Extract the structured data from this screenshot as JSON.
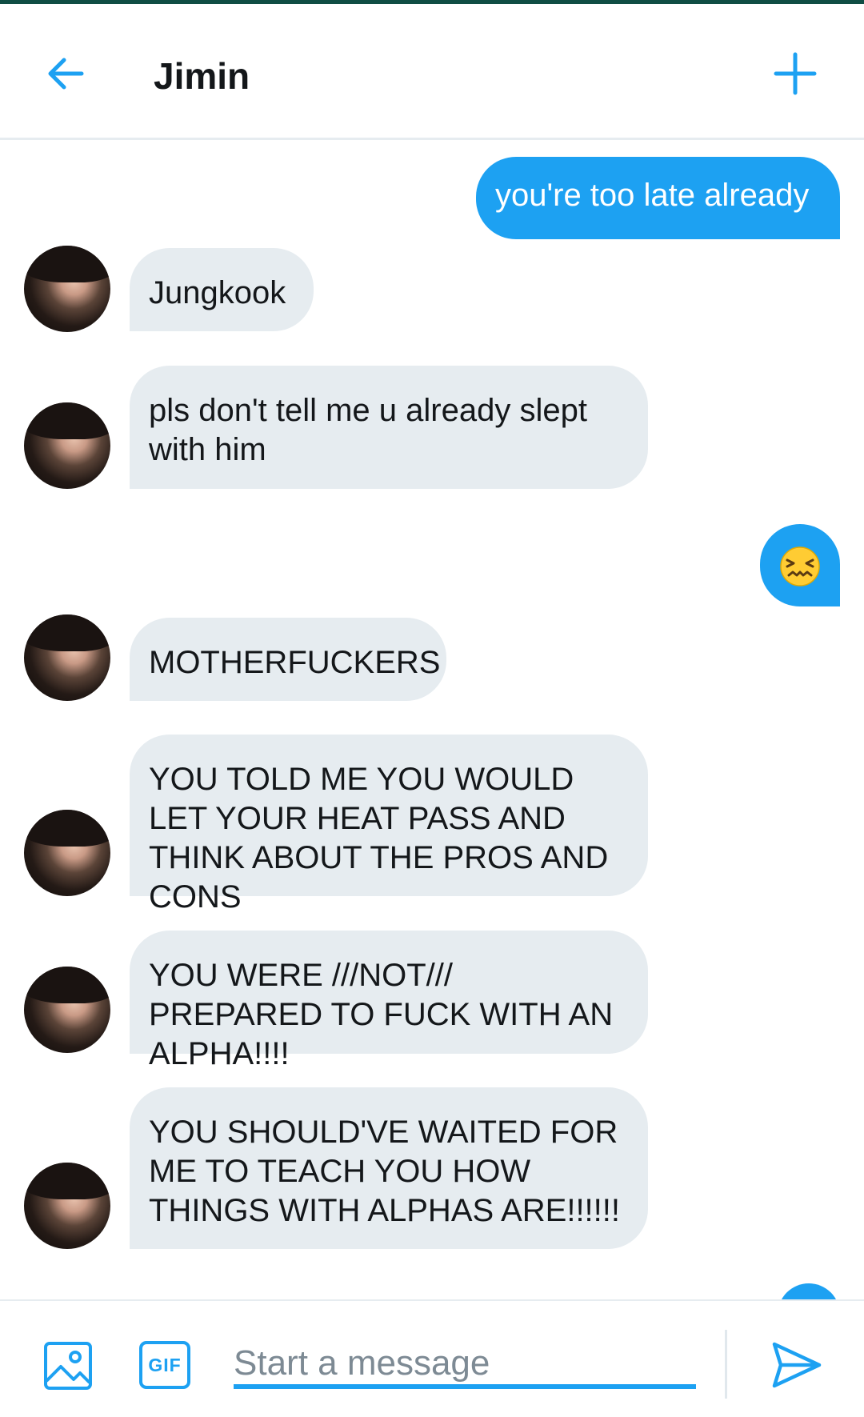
{
  "header": {
    "title": "Jimin",
    "back_icon": "arrow-left-icon",
    "new_icon": "plus-icon"
  },
  "messages": [
    {
      "side": "out",
      "text": "you're too late already"
    },
    {
      "side": "in",
      "text": "Jungkook"
    },
    {
      "side": "in",
      "text": "pls don't tell me u already slept with him"
    },
    {
      "side": "out",
      "text": "😖"
    },
    {
      "side": "in",
      "text": "MOTHERFUCKERS"
    },
    {
      "side": "in",
      "text": "YOU TOLD ME YOU WOULD LET YOUR HEAT PASS AND THINK ABOUT THE PROS AND CONS"
    },
    {
      "side": "in",
      "text": "YOU WERE ///NOT/// PREPARED TO FUCK WITH AN ALPHA!!!!"
    },
    {
      "side": "in",
      "text": "YOU SHOULD'VE WAITED FOR ME TO TEACH YOU HOW THINGS WITH ALPHAS ARE!!!!!!"
    }
  ],
  "composer": {
    "placeholder": "Start a message",
    "gif_label": "GIF",
    "image_icon": "image-icon",
    "send_icon": "send-icon"
  },
  "colors": {
    "accent": "#1da1f2",
    "incoming_bubble": "#e6ecf0",
    "top_bar": "#0f4d44"
  }
}
